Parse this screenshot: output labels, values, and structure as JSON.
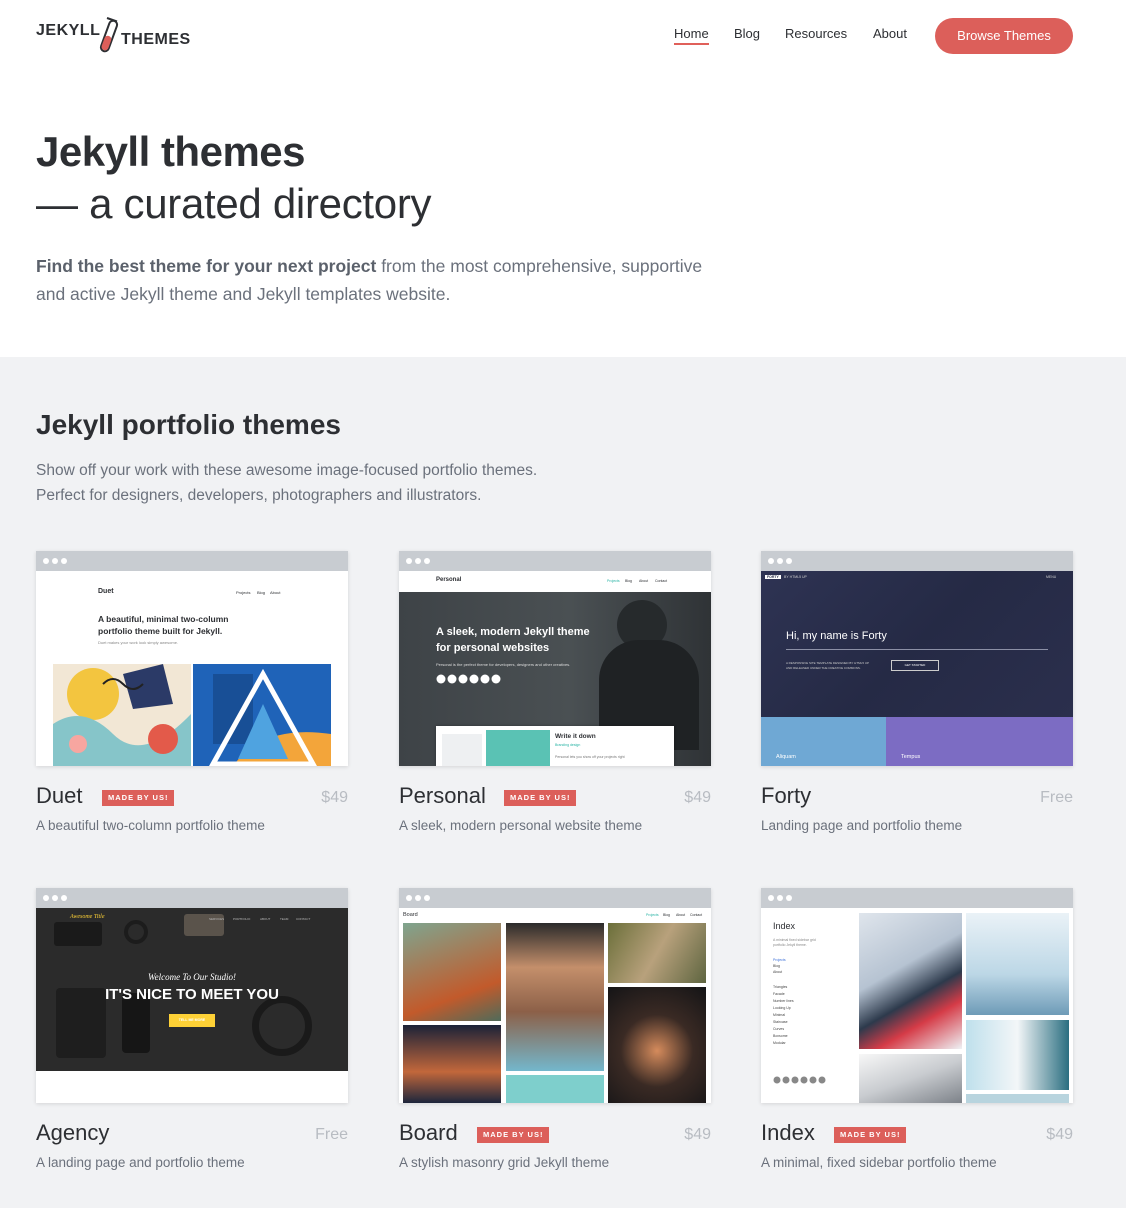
{
  "header": {
    "logo_word1": "JEKYLL",
    "logo_word2": "THEMES",
    "nav": [
      {
        "label": "Home",
        "active": true
      },
      {
        "label": "Blog",
        "active": false
      },
      {
        "label": "Resources",
        "active": false
      },
      {
        "label": "About",
        "active": false
      }
    ],
    "cta": "Browse Themes"
  },
  "hero": {
    "title": "Jekyll themes",
    "subtitle": "— a curated directory",
    "desc_bold": "Find the best theme for your next project",
    "desc_rest": " from the most comprehensive, supportive and active Jekyll theme and Jekyll templates website."
  },
  "section": {
    "title": "Jekyll portfolio themes",
    "desc_line1": "Show off your work with these awesome image-focused portfolio themes.",
    "desc_line2": "Perfect for designers, developers, photographers and illustrators."
  },
  "cards": [
    {
      "name": "Duet",
      "badge": "MADE BY US!",
      "price": "$49",
      "desc": "A beautiful two-column portfolio theme",
      "shot": {
        "brand": "Duet",
        "nav": [
          "Projects",
          "Blog",
          "About"
        ],
        "headline1": "A beautiful, minimal two-column",
        "headline2": "portfolio theme built for Jekyll.",
        "small": "Duet makes your work look simply awesome."
      }
    },
    {
      "name": "Personal",
      "badge": "MADE BY US!",
      "price": "$49",
      "desc": "A sleek, modern personal website theme",
      "shot": {
        "brand": "Personal",
        "nav": [
          "Projects",
          "Blog",
          "About",
          "Contact"
        ],
        "headline1": "A sleek, modern Jekyll theme",
        "headline2": "for personal websites",
        "small": "Personal is the perfect theme for developers, designers and other creatives.",
        "post_title": "Write it down",
        "post_sub": "Branding design",
        "post_body": "Personal lets you show off your projects right"
      }
    },
    {
      "name": "Forty",
      "badge": "",
      "price": "Free",
      "desc": "Landing page and portfolio theme",
      "shot": {
        "brand": "FORTY",
        "brand_by": "BY HTML5 UP",
        "menu": "MENU",
        "headline": "Hi, my name is Forty",
        "small1": "A RESPONSIVE SITE TEMPLATE DESIGNED BY HTML5 UP",
        "small2": "AND RELEASED UNDER THE CREATIVE COMMONS.",
        "button": "GET STARTED",
        "tile1": "Aliquam",
        "tile2": "Tempus"
      }
    },
    {
      "name": "Agency",
      "badge": "",
      "price": "Free",
      "desc": "A landing page and portfolio theme",
      "shot": {
        "brand": "Awesome Title",
        "nav": [
          "SERVICES",
          "PORTFOLIO",
          "ABOUT",
          "TEAM",
          "CONTACT"
        ],
        "welcome": "Welcome To Our Studio!",
        "headline": "IT'S NICE TO MEET YOU",
        "button": "TELL ME MORE"
      }
    },
    {
      "name": "Board",
      "badge": "MADE BY US!",
      "price": "$49",
      "desc": "A stylish masonry grid Jekyll theme",
      "shot": {
        "brand": "Board",
        "nav": [
          "Projects",
          "Blog",
          "About",
          "Contact"
        ]
      }
    },
    {
      "name": "Index",
      "badge": "MADE BY US!",
      "price": "$49",
      "desc": "A minimal, fixed sidebar portfolio theme",
      "shot": {
        "brand": "Index",
        "intro1": "A minimal fixed sidebar grid",
        "intro2": "portfolio Jekyll theme.",
        "links": [
          "Projects",
          "Blog",
          "About"
        ],
        "list": [
          "Triangles",
          "Facade",
          "Number lines",
          "Looking Up",
          "Minimal",
          "Staircase",
          "Curves",
          "Boxsome",
          "Modular"
        ]
      }
    }
  ],
  "colors": {
    "accent": "#dc5f5a",
    "section_bg": "#f1f2f4",
    "text": "#2d2f33",
    "muted": "#6b717c"
  }
}
